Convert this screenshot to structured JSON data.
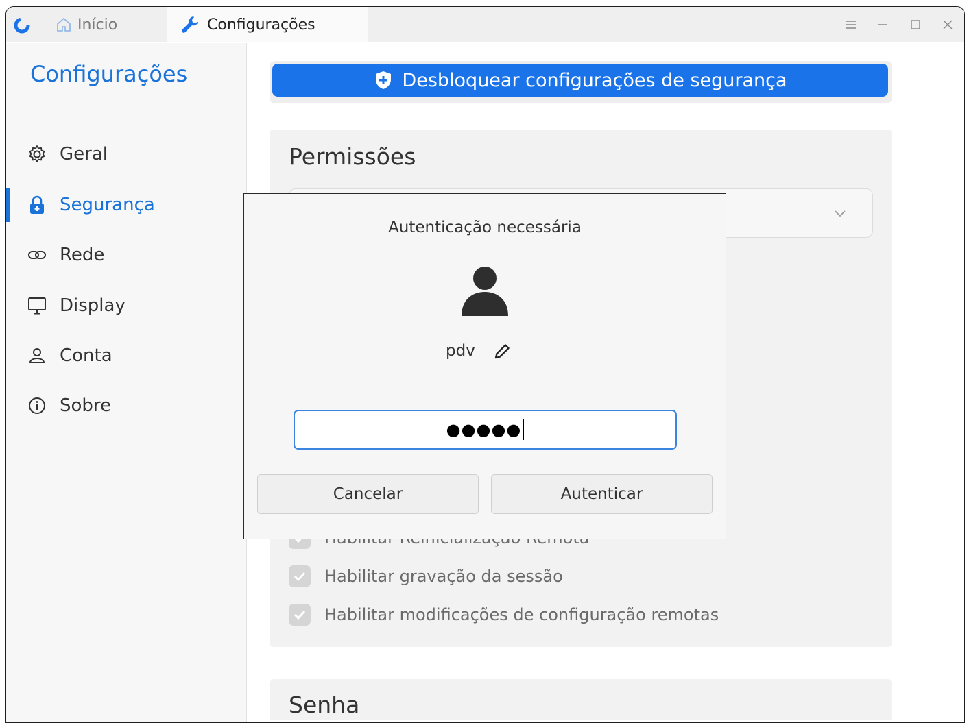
{
  "titlebar": {
    "tabs": [
      {
        "label": "Início",
        "icon": "home-icon"
      },
      {
        "label": "Configurações",
        "icon": "wrench-icon"
      }
    ],
    "controls": [
      "menu-icon",
      "minimize-icon",
      "maximize-icon",
      "close-icon"
    ]
  },
  "sidebar": {
    "title": "Configurações",
    "items": [
      {
        "label": "Geral",
        "icon": "gear-icon"
      },
      {
        "label": "Segurança",
        "icon": "lock-icon",
        "active": true
      },
      {
        "label": "Rede",
        "icon": "link-icon"
      },
      {
        "label": "Display",
        "icon": "monitor-icon"
      },
      {
        "label": "Conta",
        "icon": "user-icon"
      },
      {
        "label": "Sobre",
        "icon": "info-icon"
      }
    ]
  },
  "main": {
    "unlock_label": "Desbloquear configurações de segurança",
    "permissions": {
      "title": "Permissões",
      "checkboxes": [
        {
          "label": "Habilitar Reinicialização Remota",
          "checked": true
        },
        {
          "label": "Habilitar gravação da sessão",
          "checked": true
        },
        {
          "label": "Habilitar modificações de configuração remotas",
          "checked": true
        }
      ]
    },
    "password": {
      "title": "Senha"
    }
  },
  "dialog": {
    "title": "Autenticação necessária",
    "username": "pdv",
    "password_mask": "●●●●●",
    "cancel_label": "Cancelar",
    "confirm_label": "Autenticar"
  },
  "colors": {
    "accent": "#1a73e8",
    "sidebar_title": "#1a73d9",
    "input_focus": "#3b84e0"
  }
}
